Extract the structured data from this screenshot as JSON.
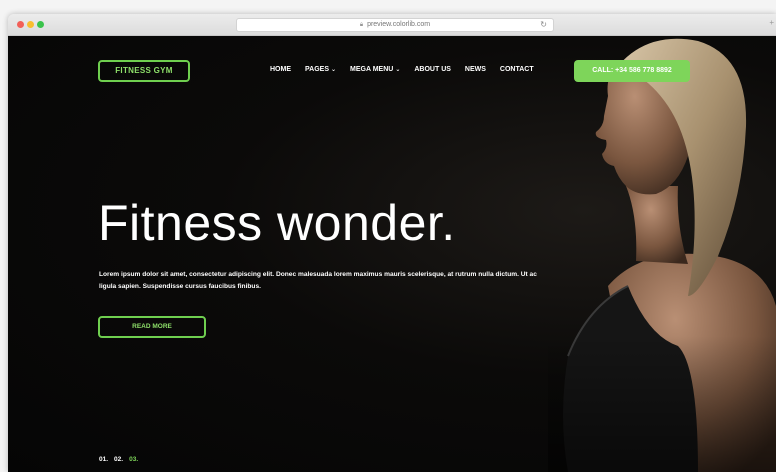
{
  "browser": {
    "url": "preview.colorlib.com"
  },
  "brand": {
    "logo": "FITNESS GYM",
    "accent": "#7ed55a"
  },
  "nav": {
    "items": [
      {
        "label": "HOME",
        "has_dropdown": false
      },
      {
        "label": "PAGES",
        "has_dropdown": true
      },
      {
        "label": "MEGA MENU",
        "has_dropdown": true
      },
      {
        "label": "ABOUT US",
        "has_dropdown": false
      },
      {
        "label": "NEWS",
        "has_dropdown": false
      },
      {
        "label": "CONTACT",
        "has_dropdown": false
      }
    ],
    "call_label": "CALL: +34 586 778 8892"
  },
  "hero": {
    "title": "Fitness wonder.",
    "text": "Lorem ipsum dolor sit amet, consectetur adipiscing elit. Donec malesuada lorem maximus mauris scelerisque, at rutrum nulla dictum. Ut ac ligula sapien. Suspendisse cursus faucibus finibus.",
    "button": "READ MORE"
  },
  "slider": {
    "items": [
      "01.",
      "02.",
      "03."
    ],
    "active_index": 2
  },
  "icons": {
    "lock": "lock-icon",
    "reload": "reload-icon",
    "chevron": "chevron-down-icon"
  }
}
